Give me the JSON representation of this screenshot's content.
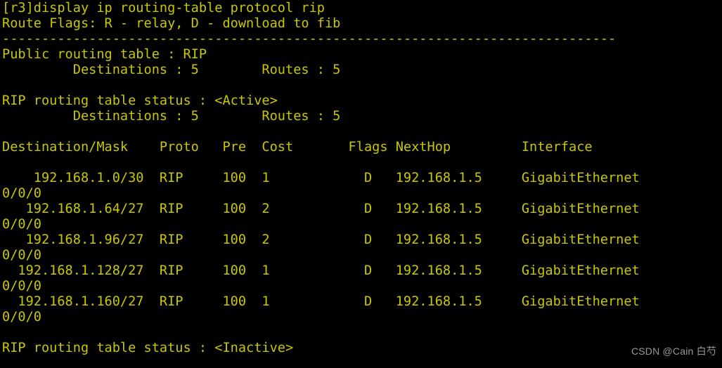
{
  "terminal": {
    "prompt": "[r3]",
    "command": "display ip routing-table protocol rip",
    "text_color": "#c8c800",
    "background_color": "#000000",
    "lines": [
      "[r3]display ip routing-table protocol rip",
      "Route Flags: R - relay, D - download to fib",
      "------------------------------------------------------------------------------",
      "Public routing table : RIP",
      "         Destinations : 5        Routes : 5",
      "",
      "RIP routing table status : <Active>",
      "         Destinations : 5        Routes : 5",
      "",
      "Destination/Mask    Proto   Pre  Cost       Flags NextHop         Interface",
      "",
      "    192.168.1.0/30  RIP     100  1            D   192.168.1.5     GigabitEthernet",
      "0/0/0",
      "   192.168.1.64/27  RIP     100  2            D   192.168.1.5     GigabitEthernet",
      "0/0/0",
      "   192.168.1.96/27  RIP     100  2            D   192.168.1.5     GigabitEthernet",
      "0/0/0",
      "  192.168.1.128/27  RIP     100  1            D   192.168.1.5     GigabitEthernet",
      "0/0/0",
      "  192.168.1.160/27  RIP     100  1            D   192.168.1.5     GigabitEthernet",
      "0/0/0",
      "",
      "RIP routing table status : <Inactive>"
    ],
    "route_flags_legend": {
      "R": "relay",
      "D": "download to fib"
    },
    "public_table": {
      "label": "Public routing table : RIP",
      "protocol": "RIP",
      "destinations_label": "Destinations",
      "destinations": "5",
      "routes_label": "Routes",
      "routes": "5"
    },
    "active_table": {
      "label": "RIP routing table status : <Active>",
      "status": "<Active>",
      "destinations_label": "Destinations",
      "destinations": "5",
      "routes_label": "Routes",
      "routes": "5"
    },
    "inactive_table": {
      "label": "RIP routing table status : <Inactive>",
      "status": "<Inactive>"
    },
    "table": {
      "headers": [
        "Destination/Mask",
        "Proto",
        "Pre",
        "Cost",
        "Flags",
        "NextHop",
        "Interface"
      ],
      "rows": [
        {
          "destination": "192.168.1.0/30",
          "proto": "RIP",
          "pre": "100",
          "cost": "1",
          "flags": "D",
          "nexthop": "192.168.1.5",
          "interface": "GigabitEthernet0/0/0"
        },
        {
          "destination": "192.168.1.64/27",
          "proto": "RIP",
          "pre": "100",
          "cost": "2",
          "flags": "D",
          "nexthop": "192.168.1.5",
          "interface": "GigabitEthernet0/0/0"
        },
        {
          "destination": "192.168.1.96/27",
          "proto": "RIP",
          "pre": "100",
          "cost": "2",
          "flags": "D",
          "nexthop": "192.168.1.5",
          "interface": "GigabitEthernet0/0/0"
        },
        {
          "destination": "192.168.1.128/27",
          "proto": "RIP",
          "pre": "100",
          "cost": "1",
          "flags": "D",
          "nexthop": "192.168.1.5",
          "interface": "GigabitEthernet0/0/0"
        },
        {
          "destination": "192.168.1.160/27",
          "proto": "RIP",
          "pre": "100",
          "cost": "1",
          "flags": "D",
          "nexthop": "192.168.1.5",
          "interface": "GigabitEthernet0/0/0"
        }
      ]
    }
  },
  "watermark": {
    "text": "CSDN @Cain 白芍",
    "color": "#9a9a9a"
  }
}
